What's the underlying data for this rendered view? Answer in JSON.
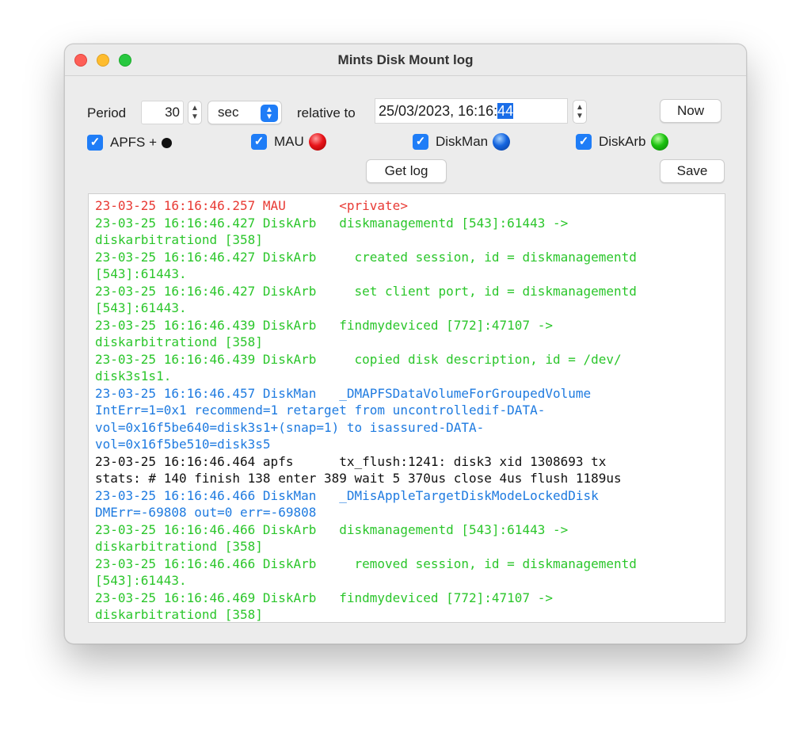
{
  "window": {
    "title": "Mints Disk Mount log"
  },
  "controls": {
    "period_label": "Period",
    "period_value": "30",
    "unit_value": "sec",
    "relative_label": "relative to",
    "date_prefix": "25/03/2023, 16:16:",
    "date_selected": "44",
    "now_label": "Now",
    "get_log_label": "Get log",
    "save_label": "Save"
  },
  "filters": [
    {
      "label": "APFS +",
      "checked": true,
      "indicator": "black-dot"
    },
    {
      "label": "MAU",
      "checked": true,
      "indicator": "red-dot"
    },
    {
      "label": "DiskMan",
      "checked": true,
      "indicator": "blue-dot"
    },
    {
      "label": "DiskArb",
      "checked": true,
      "indicator": "green-dot"
    }
  ],
  "colors": {
    "MAU": "#e83a34",
    "DiskArb": "#2bc62b",
    "DiskMan": "#1f7be0",
    "apfs": "#111111",
    "accent": "#1f7df7"
  },
  "log_lines": [
    {
      "text": "23-03-25 16:16:46.257 MAU       <private>",
      "source": "MAU"
    },
    {
      "text": "23-03-25 16:16:46.427 DiskArb   diskmanagementd [543]:61443 ->",
      "source": "DiskArb"
    },
    {
      "text": "diskarbitrationd [358]",
      "source": "DiskArb"
    },
    {
      "text": "23-03-25 16:16:46.427 DiskArb     created session, id = diskmanagementd",
      "source": "DiskArb"
    },
    {
      "text": "[543]:61443.",
      "source": "DiskArb"
    },
    {
      "text": "23-03-25 16:16:46.427 DiskArb     set client port, id = diskmanagementd",
      "source": "DiskArb"
    },
    {
      "text": "[543]:61443.",
      "source": "DiskArb"
    },
    {
      "text": "23-03-25 16:16:46.439 DiskArb   findmydeviced [772]:47107 ->",
      "source": "DiskArb"
    },
    {
      "text": "diskarbitrationd [358]",
      "source": "DiskArb"
    },
    {
      "text": "23-03-25 16:16:46.439 DiskArb     copied disk description, id = /dev/",
      "source": "DiskArb"
    },
    {
      "text": "disk3s1s1.",
      "source": "DiskArb"
    },
    {
      "text": "23-03-25 16:16:46.457 DiskMan   _DMAPFSDataVolumeForGroupedVolume",
      "source": "DiskMan"
    },
    {
      "text": "IntErr=1=0x1 recommend=1 retarget from uncontrolledif-DATA-",
      "source": "DiskMan"
    },
    {
      "text": "vol=0x16f5be640=disk3s1+(snap=1) to isassured-DATA-",
      "source": "DiskMan"
    },
    {
      "text": "vol=0x16f5be510=disk3s5",
      "source": "DiskMan"
    },
    {
      "text": "23-03-25 16:16:46.464 apfs      tx_flush:1241: disk3 xid 1308693 tx",
      "source": "apfs"
    },
    {
      "text": "stats: # 140 finish 138 enter 389 wait 5 370us close 4us flush 1189us",
      "source": "apfs"
    },
    {
      "text": "23-03-25 16:16:46.466 DiskMan   _DMisAppleTargetDiskModeLockedDisk",
      "source": "DiskMan"
    },
    {
      "text": "DMErr=-69808 out=0 err=-69808",
      "source": "DiskMan"
    },
    {
      "text": "23-03-25 16:16:46.466 DiskArb   diskmanagementd [543]:61443 ->",
      "source": "DiskArb"
    },
    {
      "text": "diskarbitrationd [358]",
      "source": "DiskArb"
    },
    {
      "text": "23-03-25 16:16:46.466 DiskArb     removed session, id = diskmanagementd",
      "source": "DiskArb"
    },
    {
      "text": "[543]:61443.",
      "source": "DiskArb"
    },
    {
      "text": "23-03-25 16:16:46.469 DiskArb   findmydeviced [772]:47107 ->",
      "source": "DiskArb"
    },
    {
      "text": "diskarbitrationd [358]",
      "source": "DiskArb"
    }
  ]
}
